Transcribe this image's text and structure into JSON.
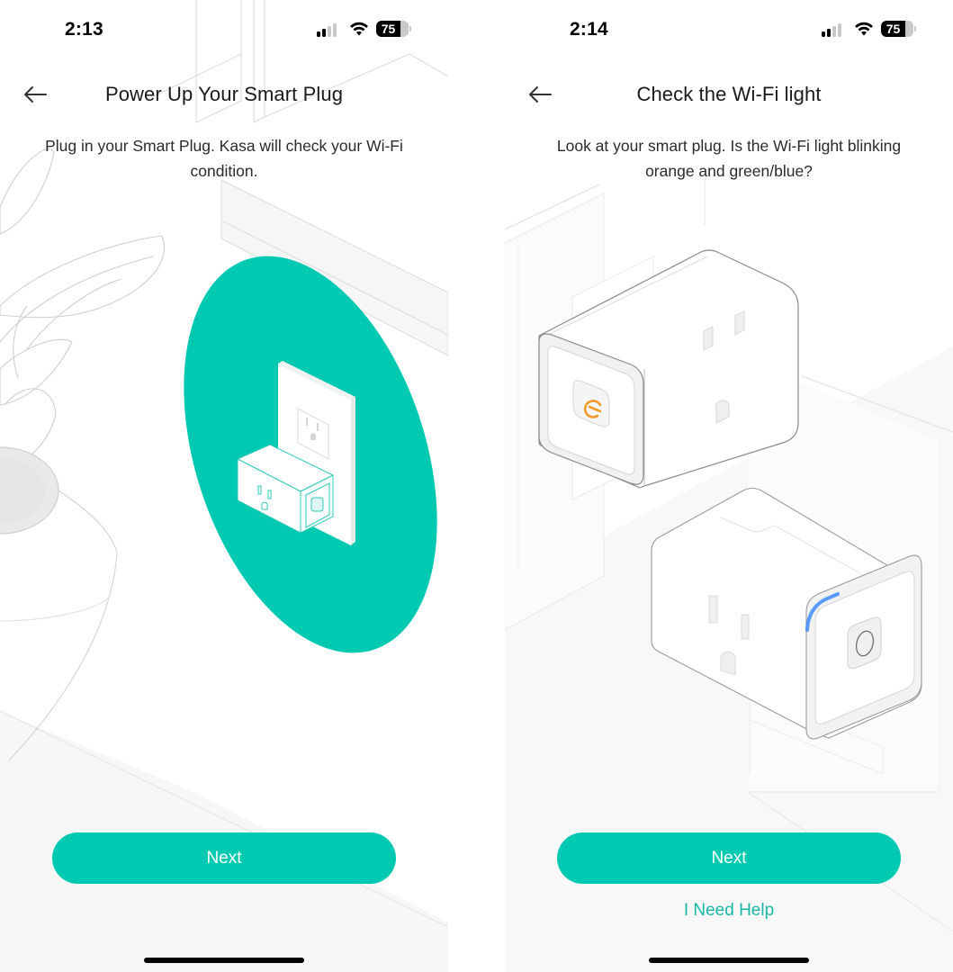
{
  "theme": {
    "accent": "#00c9b2",
    "link_color": "#19b8a6",
    "plug_led_orange": "#f39a2b",
    "plug_led_blue": "#3d8bff"
  },
  "screens": [
    {
      "status_bar": {
        "time": "2:13",
        "signal_bars_active": 2,
        "signal_bars_total": 4,
        "wifi_icon": "wifi-icon",
        "battery_percent": 75,
        "battery_label": "75"
      },
      "header": {
        "back_icon": "arrow-left-icon",
        "title": "Power Up Your Smart Plug"
      },
      "description": "Plug in your Smart Plug. Kasa will check your Wi-Fi condition.",
      "illustration": "smart-plug-in-wall-outlet-with-plant",
      "buttons": {
        "next_label": "Next"
      }
    },
    {
      "status_bar": {
        "time": "2:14",
        "signal_bars_active": 2,
        "signal_bars_total": 4,
        "wifi_icon": "wifi-icon",
        "battery_percent": 75,
        "battery_label": "75"
      },
      "header": {
        "back_icon": "arrow-left-icon",
        "title": "Check the Wi-Fi light"
      },
      "description": "Look at your smart plug. Is the Wi-Fi light blinking orange and green/blue?",
      "illustration": "two-smart-plugs-orange-and-blue-leds",
      "buttons": {
        "next_label": "Next",
        "help_label": "I Need Help"
      }
    }
  ]
}
